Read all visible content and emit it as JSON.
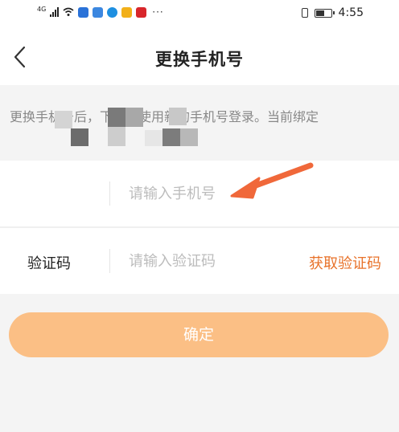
{
  "status_bar": {
    "network": "4G",
    "more": "···",
    "time": "4:55",
    "battery_level": 0.6
  },
  "nav": {
    "title": "更换手机号"
  },
  "notice": {
    "text": "更换手机号后，下次请使用新的手机号登录。当前绑定"
  },
  "phone_row": {
    "label": "",
    "placeholder": "请输入手机号",
    "value": ""
  },
  "code_row": {
    "label": "验证码",
    "placeholder": "请输入验证码",
    "value": "",
    "get_code": "获取验证码"
  },
  "confirm_button": {
    "label": "确定"
  },
  "colors": {
    "accent": "#e8722a",
    "button": "#fbbf85",
    "arrow": "#f0683a"
  }
}
